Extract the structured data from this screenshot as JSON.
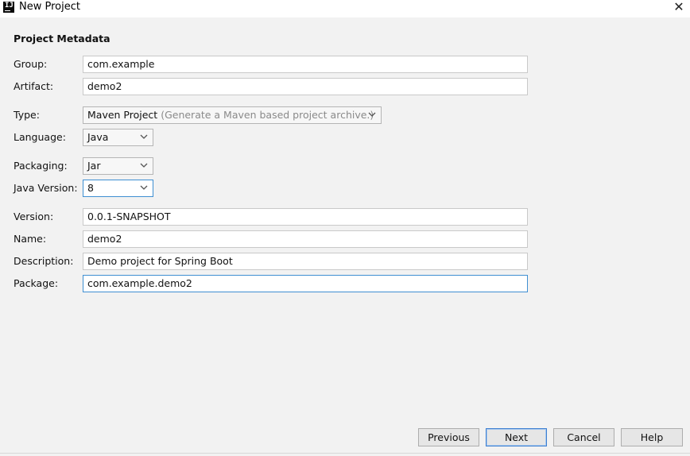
{
  "window": {
    "title": "New Project",
    "close_glyph": "✕",
    "app_icon_text": "IJ"
  },
  "section_title": "Project Metadata",
  "fields": {
    "group": {
      "label": "Group:",
      "value": "com.example"
    },
    "artifact": {
      "label": "Artifact:",
      "value": "demo2"
    },
    "type": {
      "label": "Type:",
      "value": "Maven Project",
      "hint": "(Generate a Maven based project archive.)"
    },
    "language": {
      "label": "Language:",
      "value": "Java"
    },
    "packaging": {
      "label": "Packaging:",
      "value": "Jar"
    },
    "java_version": {
      "label": "Java Version:",
      "value": "8"
    },
    "version": {
      "label": "Version:",
      "value": "0.0.1-SNAPSHOT"
    },
    "name": {
      "label": "Name:",
      "value": "demo2"
    },
    "description": {
      "label": "Description:",
      "value": "Demo project for Spring Boot"
    },
    "package": {
      "label": "Package:",
      "value": "com.example.demo2"
    }
  },
  "buttons": {
    "previous": "Previous",
    "next": "Next",
    "cancel": "Cancel",
    "help": "Help"
  },
  "colors": {
    "focus_border": "#3f8fd2",
    "background": "#f2f2f2"
  }
}
